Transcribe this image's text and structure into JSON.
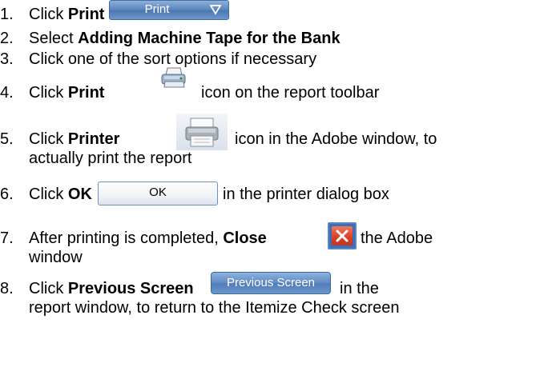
{
  "steps": [
    {
      "num": "1.",
      "pre": "Click ",
      "bold": "Print",
      "post": ""
    },
    {
      "num": "2.",
      "pre": "Select ",
      "bold": "Adding Machine Tape for the Bank",
      "post": ""
    },
    {
      "num": "3.",
      "pre": "Click one of the sort options if necessary",
      "bold": "",
      "post": ""
    },
    {
      "num": "4.",
      "pre": "Click ",
      "bold": "Print",
      "post": "icon on the report toolbar"
    },
    {
      "num": "5.",
      "pre": "Click ",
      "bold": "Printer",
      "post": "icon in the Adobe window, to",
      "line2": "actually print the report"
    },
    {
      "num": "6.",
      "pre": "Click ",
      "bold": "OK",
      "post": "in the printer dialog box"
    },
    {
      "num": "7.",
      "pre": "After printing is completed, ",
      "bold": "Close",
      "post": "the Adobe",
      "line2": "window"
    },
    {
      "num": "8.",
      "pre": "Click ",
      "bold": "Previous Screen",
      "post": "in the",
      "line2": "report window, to return to the Itemize Check screen"
    }
  ],
  "buttons": {
    "print_label": "Print",
    "ok_label": "OK",
    "previous_screen_label": "Previous Screen"
  },
  "icons": {
    "print_dropdown": "chevron-down-icon",
    "toolbar_print": "print-icon",
    "printer": "printer-icon",
    "close": "close-icon"
  },
  "colors": {
    "button_blue": "#5e88c0",
    "close_red": "#d9432a",
    "text": "#000000"
  }
}
